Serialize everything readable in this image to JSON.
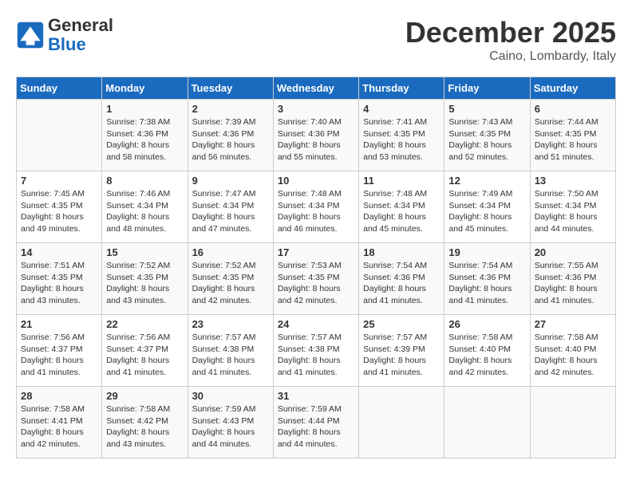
{
  "header": {
    "logo_line1": "General",
    "logo_line2": "Blue",
    "month": "December 2025",
    "location": "Caino, Lombardy, Italy"
  },
  "days_of_week": [
    "Sunday",
    "Monday",
    "Tuesday",
    "Wednesday",
    "Thursday",
    "Friday",
    "Saturday"
  ],
  "weeks": [
    [
      {
        "day": "",
        "content": ""
      },
      {
        "day": "1",
        "content": "Sunrise: 7:38 AM\nSunset: 4:36 PM\nDaylight: 8 hours\nand 58 minutes."
      },
      {
        "day": "2",
        "content": "Sunrise: 7:39 AM\nSunset: 4:36 PM\nDaylight: 8 hours\nand 56 minutes."
      },
      {
        "day": "3",
        "content": "Sunrise: 7:40 AM\nSunset: 4:36 PM\nDaylight: 8 hours\nand 55 minutes."
      },
      {
        "day": "4",
        "content": "Sunrise: 7:41 AM\nSunset: 4:35 PM\nDaylight: 8 hours\nand 53 minutes."
      },
      {
        "day": "5",
        "content": "Sunrise: 7:43 AM\nSunset: 4:35 PM\nDaylight: 8 hours\nand 52 minutes."
      },
      {
        "day": "6",
        "content": "Sunrise: 7:44 AM\nSunset: 4:35 PM\nDaylight: 8 hours\nand 51 minutes."
      }
    ],
    [
      {
        "day": "7",
        "content": "Sunrise: 7:45 AM\nSunset: 4:35 PM\nDaylight: 8 hours\nand 49 minutes."
      },
      {
        "day": "8",
        "content": "Sunrise: 7:46 AM\nSunset: 4:34 PM\nDaylight: 8 hours\nand 48 minutes."
      },
      {
        "day": "9",
        "content": "Sunrise: 7:47 AM\nSunset: 4:34 PM\nDaylight: 8 hours\nand 47 minutes."
      },
      {
        "day": "10",
        "content": "Sunrise: 7:48 AM\nSunset: 4:34 PM\nDaylight: 8 hours\nand 46 minutes."
      },
      {
        "day": "11",
        "content": "Sunrise: 7:48 AM\nSunset: 4:34 PM\nDaylight: 8 hours\nand 45 minutes."
      },
      {
        "day": "12",
        "content": "Sunrise: 7:49 AM\nSunset: 4:34 PM\nDaylight: 8 hours\nand 45 minutes."
      },
      {
        "day": "13",
        "content": "Sunrise: 7:50 AM\nSunset: 4:34 PM\nDaylight: 8 hours\nand 44 minutes."
      }
    ],
    [
      {
        "day": "14",
        "content": "Sunrise: 7:51 AM\nSunset: 4:35 PM\nDaylight: 8 hours\nand 43 minutes."
      },
      {
        "day": "15",
        "content": "Sunrise: 7:52 AM\nSunset: 4:35 PM\nDaylight: 8 hours\nand 43 minutes."
      },
      {
        "day": "16",
        "content": "Sunrise: 7:52 AM\nSunset: 4:35 PM\nDaylight: 8 hours\nand 42 minutes."
      },
      {
        "day": "17",
        "content": "Sunrise: 7:53 AM\nSunset: 4:35 PM\nDaylight: 8 hours\nand 42 minutes."
      },
      {
        "day": "18",
        "content": "Sunrise: 7:54 AM\nSunset: 4:36 PM\nDaylight: 8 hours\nand 41 minutes."
      },
      {
        "day": "19",
        "content": "Sunrise: 7:54 AM\nSunset: 4:36 PM\nDaylight: 8 hours\nand 41 minutes."
      },
      {
        "day": "20",
        "content": "Sunrise: 7:55 AM\nSunset: 4:36 PM\nDaylight: 8 hours\nand 41 minutes."
      }
    ],
    [
      {
        "day": "21",
        "content": "Sunrise: 7:56 AM\nSunset: 4:37 PM\nDaylight: 8 hours\nand 41 minutes."
      },
      {
        "day": "22",
        "content": "Sunrise: 7:56 AM\nSunset: 4:37 PM\nDaylight: 8 hours\nand 41 minutes."
      },
      {
        "day": "23",
        "content": "Sunrise: 7:57 AM\nSunset: 4:38 PM\nDaylight: 8 hours\nand 41 minutes."
      },
      {
        "day": "24",
        "content": "Sunrise: 7:57 AM\nSunset: 4:38 PM\nDaylight: 8 hours\nand 41 minutes."
      },
      {
        "day": "25",
        "content": "Sunrise: 7:57 AM\nSunset: 4:39 PM\nDaylight: 8 hours\nand 41 minutes."
      },
      {
        "day": "26",
        "content": "Sunrise: 7:58 AM\nSunset: 4:40 PM\nDaylight: 8 hours\nand 42 minutes."
      },
      {
        "day": "27",
        "content": "Sunrise: 7:58 AM\nSunset: 4:40 PM\nDaylight: 8 hours\nand 42 minutes."
      }
    ],
    [
      {
        "day": "28",
        "content": "Sunrise: 7:58 AM\nSunset: 4:41 PM\nDaylight: 8 hours\nand 42 minutes."
      },
      {
        "day": "29",
        "content": "Sunrise: 7:58 AM\nSunset: 4:42 PM\nDaylight: 8 hours\nand 43 minutes."
      },
      {
        "day": "30",
        "content": "Sunrise: 7:59 AM\nSunset: 4:43 PM\nDaylight: 8 hours\nand 44 minutes."
      },
      {
        "day": "31",
        "content": "Sunrise: 7:59 AM\nSunset: 4:44 PM\nDaylight: 8 hours\nand 44 minutes."
      },
      {
        "day": "",
        "content": ""
      },
      {
        "day": "",
        "content": ""
      },
      {
        "day": "",
        "content": ""
      }
    ]
  ]
}
